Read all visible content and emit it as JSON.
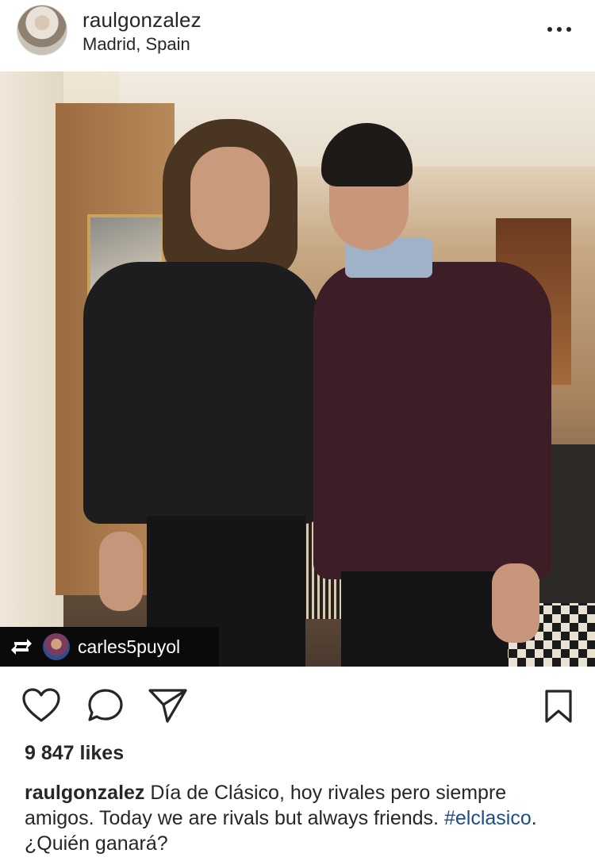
{
  "post": {
    "username": "raulgonzalez",
    "location": "Madrid, Spain",
    "repost_user": "carles5puyol",
    "likes": "9 847 likes",
    "caption_pre": "Día de Clásico, hoy rivales pero siempre amigos.  Today we are rivals but always friends. ",
    "hashtag": "#elclasico",
    "caption_post": ". ¿Quién ganará?"
  },
  "icons": {
    "more": "more-options-icon",
    "like": "heart-icon",
    "comment": "comment-icon",
    "share": "share-icon",
    "save": "bookmark-icon",
    "repost": "repost-icon"
  },
  "colors": {
    "text": "#262626",
    "hashtag": "#1c4d8c",
    "tag_background": "#0a0a0a"
  }
}
